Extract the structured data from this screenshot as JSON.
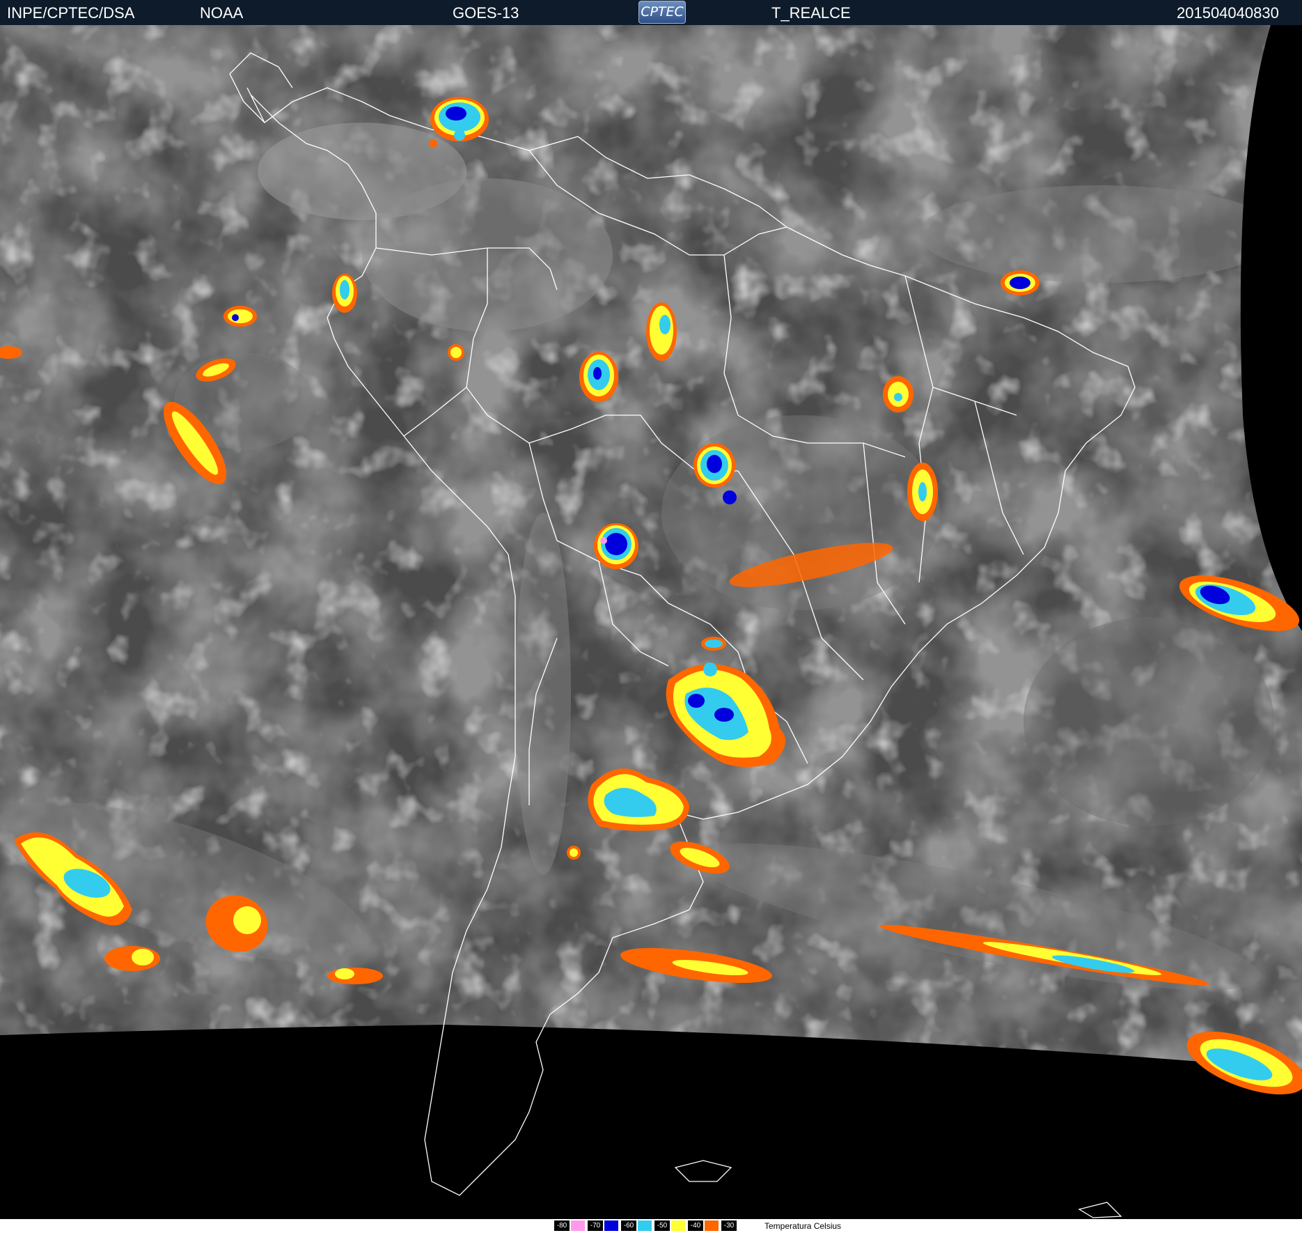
{
  "header": {
    "left": "INPE/CPTEC/DSA",
    "agency": "NOAA",
    "satellite": "GOES-13",
    "logo_text": "CPTEC",
    "product": "T_REALCE",
    "timestamp": "201504040830"
  },
  "legend": {
    "title": "Temperatura   Celsius",
    "items": [
      {
        "label": "-80",
        "color": "#ff99ee"
      },
      {
        "label": "-70",
        "color": "#0000dd"
      },
      {
        "label": "-60",
        "color": "#33ccee"
      },
      {
        "label": "-50",
        "color": "#ffff33"
      },
      {
        "label": "-40",
        "color": "#ff6600"
      },
      {
        "label": "-30",
        "color": ""
      }
    ]
  },
  "colors": {
    "space": "#000000",
    "cloud_base": "#4a4a4a",
    "cloud_light": "#9a9a9a",
    "borders": "#ffffff"
  }
}
